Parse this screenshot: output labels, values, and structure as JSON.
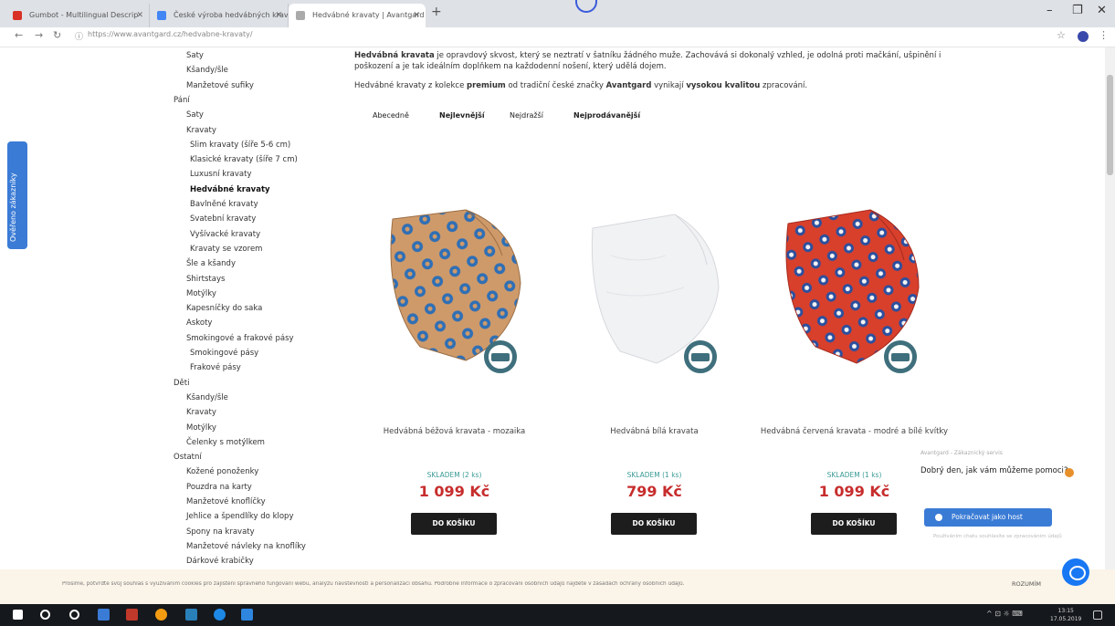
{
  "browser": {
    "tabs": [
      {
        "title": "Gumbot - Multilingual Descrip",
        "color": "#d93025"
      },
      {
        "title": "České výroba hedvábných kravat",
        "color": "#4285f4"
      },
      {
        "title": "Hedvábné kravaty | Avantgard",
        "color": "#aaaaaa"
      }
    ],
    "url": "https://www.avantgard.cz/hedvabne-kravaty/"
  },
  "side_tab": {
    "label": "Ověřeno zákazníky"
  },
  "menu": {
    "items": [
      {
        "label": "Saty",
        "indent": 1,
        "bold": false
      },
      {
        "label": "Kšandy/šle",
        "indent": 1,
        "bold": false
      },
      {
        "label": "Manžetové sufiky",
        "indent": 1,
        "bold": false
      },
      {
        "label": "Pání",
        "indent": 0,
        "bold": false
      },
      {
        "label": "Saty",
        "indent": 1,
        "bold": false
      },
      {
        "label": "Kravaty",
        "indent": 1,
        "bold": false
      },
      {
        "label": "Slim kravaty (šíře 5-6 cm)",
        "indent": 2,
        "bold": false
      },
      {
        "label": "Klasické kravaty (šíře 7 cm)",
        "indent": 2,
        "bold": false
      },
      {
        "label": "Luxusní kravaty",
        "indent": 2,
        "bold": false
      },
      {
        "label": "Hedvábné kravaty",
        "indent": 2,
        "bold": true
      },
      {
        "label": "Bavlněné kravaty",
        "indent": 2,
        "bold": false
      },
      {
        "label": "Svatební kravaty",
        "indent": 2,
        "bold": false
      },
      {
        "label": "Vyšívacké kravaty",
        "indent": 2,
        "bold": false
      },
      {
        "label": "Kravaty se vzorem",
        "indent": 2,
        "bold": false
      },
      {
        "label": "Šle a kšandy",
        "indent": 1,
        "bold": false
      },
      {
        "label": "Shirtstays",
        "indent": 1,
        "bold": false
      },
      {
        "label": "Motýlky",
        "indent": 1,
        "bold": false
      },
      {
        "label": "Kapesníčky do saka",
        "indent": 1,
        "bold": false
      },
      {
        "label": "Askoty",
        "indent": 1,
        "bold": false
      },
      {
        "label": "Smokingové a frakové pásy",
        "indent": 1,
        "bold": false
      },
      {
        "label": "Smokingové pásy",
        "indent": 2,
        "bold": false
      },
      {
        "label": "Frakové pásy",
        "indent": 2,
        "bold": false
      },
      {
        "label": "Děti",
        "indent": 0,
        "bold": false
      },
      {
        "label": "Kšandy/šle",
        "indent": 1,
        "bold": false
      },
      {
        "label": "Kravaty",
        "indent": 1,
        "bold": false
      },
      {
        "label": "Motýlky",
        "indent": 1,
        "bold": false
      },
      {
        "label": "Čelenky s motýlkem",
        "indent": 1,
        "bold": false
      },
      {
        "label": "Ostatní",
        "indent": 0,
        "bold": false
      },
      {
        "label": "Kožené ponoženky",
        "indent": 1,
        "bold": false
      },
      {
        "label": "Pouzdra na karty",
        "indent": 1,
        "bold": false
      },
      {
        "label": "Manžetové knoflíčky",
        "indent": 1,
        "bold": false
      },
      {
        "label": "Jehlice a špendlíky do klopy",
        "indent": 1,
        "bold": false
      },
      {
        "label": "Spony na kravaty",
        "indent": 1,
        "bold": false
      },
      {
        "label": "Manžetové návleky na knoflíky",
        "indent": 1,
        "bold": false
      },
      {
        "label": "Dárkové krabičky",
        "indent": 1,
        "bold": false
      }
    ]
  },
  "intro": {
    "lead_bold": "Hedvábná kravata",
    "lead_rest": " je opravdový skvost, který se neztratí v šatníku žádného muže. Zachovává si dokonalý vzhled, je odolná proti mačkání, ušpinění i poškození a je tak ideálním doplňkem na každodenní nošení, který udělá dojem.",
    "line2_a": "Hedvábné kravaty z kolekce ",
    "line2_b": "premium",
    "line2_c": " od tradiční české značky ",
    "line2_d": "Avantgard",
    "line2_e": " vynikají ",
    "line2_f": "vysokou kvalitou",
    "line2_g": " zpracování."
  },
  "sort": [
    {
      "label": "Abecedně",
      "active": false
    },
    {
      "label": "Nejlevnější",
      "active": true
    },
    {
      "label": "Nejdražší",
      "active": false
    },
    {
      "label": "Nejprodávanější",
      "active": true
    }
  ],
  "products": [
    {
      "name": "Hedvábná béžová kravata - mozaika",
      "stock": "SKLADEM (2 ks)",
      "price": "1 099 Kč",
      "cart": "DO KOŠÍKU",
      "tie_color": "#cf9a6a",
      "dot_color": "#2f6fb5"
    },
    {
      "name": "Hedvábná bílá kravata",
      "stock": "SKLADEM (1 ks)",
      "price": "799 Kč",
      "cart": "DO KOŠÍKU",
      "tie_color": "#f1f2f4",
      "dot_color": "#e4e6ea"
    },
    {
      "name": "Hedvábná červená kravata - modré a bílé kvítky",
      "stock": "SKLADEM (1 ks)",
      "price": "1 099 Kč",
      "cart": "DO KOŠÍKU",
      "tie_color": "#d8402c",
      "dot_color": "#2c4f9e"
    }
  ],
  "chat": {
    "header": "Avantgard - Zákaznický servis",
    "message": "Dobrý den, jak vám můžeme pomoci?",
    "button": "Pokračovat jako host",
    "sub": "Používáním chatu souhlasíte se zpracováním údajů"
  },
  "cookie": {
    "text": "Prosíme, potvrďte svůj souhlas s využíváním cookies pro zajištění správného fungování webu, analýzu návštěvnosti a personalizaci obsahu. Podrobné informace o zpracování osobních údajů najdete v zásadách ochrany osobních údajů.",
    "accept": "ROZUMÍM"
  },
  "taskbar": {
    "tray": "^ ⊡ ☼ ⌨ ",
    "clock_time": "13:15",
    "clock_date": "17.05.2019",
    "icon_colors": [
      "#ffffff",
      "#ffffff",
      "#ffffff",
      "#3a7bd5",
      "#c0392b",
      "#f39c12",
      "#2980b9",
      "#1e88e5",
      "#2e86de"
    ]
  }
}
